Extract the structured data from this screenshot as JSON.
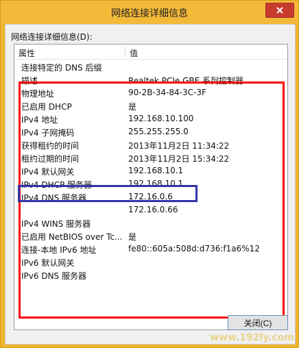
{
  "window": {
    "title": "网络连接详细信息"
  },
  "main": {
    "label": "网络连接详细信息(D):",
    "header": {
      "property": "属性",
      "value": "值"
    },
    "rows": [
      {
        "p": "连接特定的 DNS 后缀",
        "v": ""
      },
      {
        "p": "描述",
        "v": "Realtek PCIe GBE 系列控制器"
      },
      {
        "p": "物理地址",
        "v": "90-2B-34-84-3C-3F"
      },
      {
        "p": "已启用 DHCP",
        "v": "是"
      },
      {
        "p": "IPv4 地址",
        "v": "192.168.10.100"
      },
      {
        "p": "IPv4 子网掩码",
        "v": "255.255.255.0"
      },
      {
        "p": "获得租约的时间",
        "v": "2013年11月2日 11:34:22"
      },
      {
        "p": "租约过期的时间",
        "v": "2013年11月2日 15:34:22"
      },
      {
        "p": "IPv4 默认网关",
        "v": "192.168.10.1"
      },
      {
        "p": "IPv4 DHCP 服务器",
        "v": "192.168.10.1"
      },
      {
        "p": "IPv4 DNS 服务器",
        "v": "172.16.0.6"
      },
      {
        "p": "",
        "v": "172.16.0.66"
      },
      {
        "p": "IPv4 WINS 服务器",
        "v": ""
      },
      {
        "p": "已启用 NetBIOS over Tc...",
        "v": "是"
      },
      {
        "p": "连接-本地 IPv6 地址",
        "v": "fe80::605a:508d:d736:f1a6%12"
      },
      {
        "p": "IPv6 默认网关",
        "v": ""
      },
      {
        "p": "IPv6 DNS 服务器",
        "v": ""
      }
    ]
  },
  "buttons": {
    "close": "关闭(C)"
  },
  "watermark": "www.192ly.com",
  "colors": {
    "title_bar": "#f3b938",
    "close": "#c83b2f",
    "highlight_red": "#ff0000",
    "highlight_blue": "#3333aa"
  }
}
